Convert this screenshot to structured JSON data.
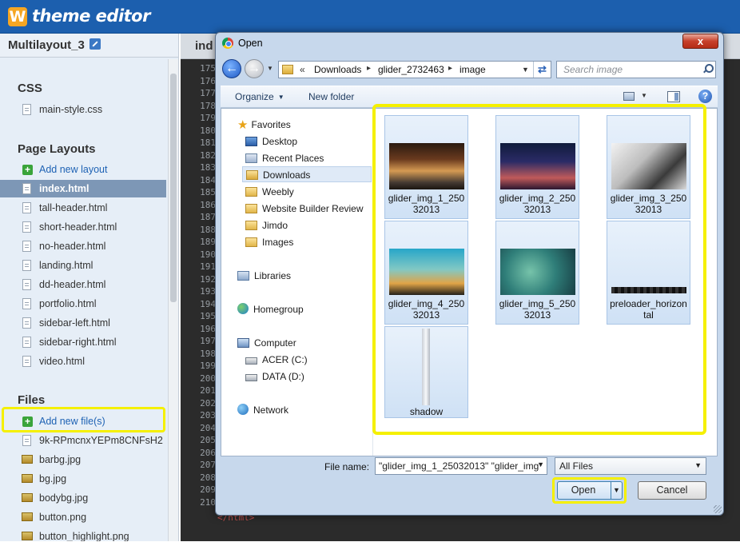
{
  "app": {
    "logo": "W",
    "title": "theme editor"
  },
  "sidebar": {
    "project_name": "Multilayout_3",
    "css_heading": "CSS",
    "css_files": [
      "main-style.css"
    ],
    "layouts_heading": "Page Layouts",
    "add_layout": "Add new layout",
    "layouts": [
      "index.html",
      "tall-header.html",
      "short-header.html",
      "no-header.html",
      "landing.html",
      "dd-header.html",
      "portfolio.html",
      "sidebar-left.html",
      "sidebar-right.html",
      "video.html"
    ],
    "active_layout": "index.html",
    "files_heading": "Files",
    "add_file": "Add new file(s)",
    "files": [
      "9k-RPmcnxYEPm8CNFsH2",
      "barbg.jpg",
      "bg.jpg",
      "bodybg.jpg",
      "button.png",
      "button_highlight.png"
    ]
  },
  "editor": {
    "tab": "ind",
    "line_numbers": [
      "175",
      "176",
      "177",
      "178",
      "179",
      "180",
      "181",
      "182",
      "183",
      "184",
      "185",
      "186",
      "187",
      "188",
      "189",
      "190",
      "191",
      "192",
      "193",
      "194",
      "195",
      "196",
      "197",
      "198",
      "199",
      "200",
      "201",
      "202",
      "203",
      "204",
      "205",
      "206",
      "207",
      "208",
      "209",
      "210"
    ],
    "last_line_text": "</html>"
  },
  "dialog": {
    "title": "Open",
    "close": "x",
    "breadcrumb": [
      "Downloads",
      "glider_2732463",
      "image"
    ],
    "breadcrumb_prefix": "«",
    "search_placeholder": "Search image",
    "toolbar": {
      "organize": "Organize",
      "new_folder": "New folder"
    },
    "nav": {
      "favorites": "Favorites",
      "desktop": "Desktop",
      "recent": "Recent Places",
      "downloads": "Downloads",
      "weebly": "Weebly",
      "review": "Website Builder Review",
      "jimdo": "Jimdo",
      "images": "Images",
      "libraries": "Libraries",
      "homegroup": "Homegroup",
      "computer": "Computer",
      "drive_c": "ACER (C:)",
      "drive_d": "DATA (D:)",
      "network": "Network"
    },
    "files": [
      {
        "name": "glider_img_1_25032013",
        "selected": true
      },
      {
        "name": "glider_img_2_25032013",
        "selected": true
      },
      {
        "name": "glider_img_3_25032013",
        "selected": true
      },
      {
        "name": "glider_img_4_25032013",
        "selected": true
      },
      {
        "name": "glider_img_5_25032013",
        "selected": true
      },
      {
        "name": "preloader_horizontal",
        "selected": true
      },
      {
        "name": "shadow",
        "selected": true
      }
    ],
    "file_name_label": "File name:",
    "file_name_value": "\"glider_img_1_25032013\" \"glider_img",
    "file_type": "All Files",
    "open": "Open",
    "cancel": "Cancel"
  },
  "colors": {
    "topbar": "#1c5fae",
    "highlight": "#f5f000",
    "selection": "#cfe1f5"
  }
}
